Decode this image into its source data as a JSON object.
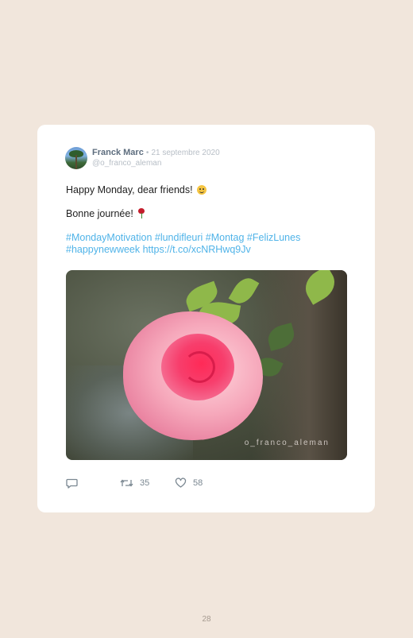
{
  "tweet": {
    "author": "Franck Marc",
    "separator": "•",
    "date": "21 septembre 2020",
    "handle": "@o_franco_aleman",
    "line1": "Happy Monday, dear friends!",
    "line2": "Bonne journée!",
    "hashtags": "#MondayMotivation #lundifleuri #Montag #FelizLunes #happynewweek https://t.co/xcNRHwq9Jv",
    "photo_watermark": "o_franco_aleman",
    "retweets": "35",
    "likes": "58"
  },
  "icons": {
    "avatar": "avatar-palm-tree",
    "line1_emoji": "smiling-face-emoji",
    "line2_emoji": "rose-emoji",
    "reply": "reply-icon",
    "retweet": "retweet-icon",
    "like": "heart-icon"
  },
  "colors": {
    "background": "#f1e6dc",
    "card": "#ffffff",
    "link": "#4fb3e8",
    "muted": "#b7bec6"
  },
  "page_number": "28"
}
